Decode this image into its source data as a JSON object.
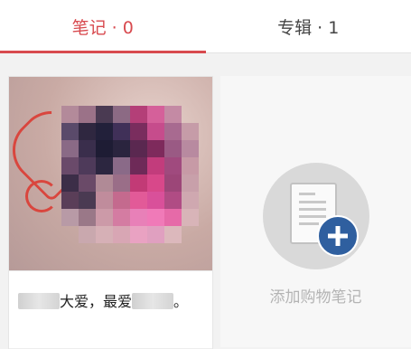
{
  "tabs": [
    {
      "label": "笔记 · 0",
      "active": true
    },
    {
      "label": "专辑 · 1",
      "active": false
    }
  ],
  "note_card": {
    "caption_part1": "大爱，最爱",
    "caption_part2": "。"
  },
  "add_note": {
    "label": "添加购物笔记"
  },
  "colors": {
    "accent": "#d84a4f",
    "plus_circle": "#2f5f9f"
  }
}
